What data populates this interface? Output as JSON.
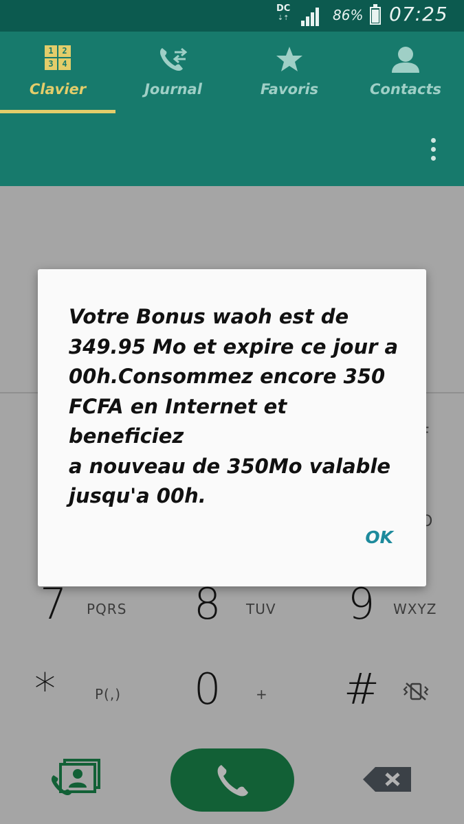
{
  "status_bar": {
    "network": "DC",
    "battery_percent": "86%",
    "battery_level": 0.86,
    "time": "07:25"
  },
  "tabs": [
    {
      "label": "Clavier",
      "icon": "keypad-icon",
      "active": true
    },
    {
      "label": "Journal",
      "icon": "call-log-icon",
      "active": false
    },
    {
      "label": "Favoris",
      "icon": "star-icon",
      "active": false
    },
    {
      "label": "Contacts",
      "icon": "person-icon",
      "active": false
    }
  ],
  "keypad_icon_digits": [
    "1",
    "2",
    "3",
    "4"
  ],
  "dialog": {
    "message_lines": [
      "Votre Bonus waoh est de",
      "349.95 Mo et expire ce jour a",
      "00h.Consommez encore 350",
      "FCFA en Internet et beneficiez",
      "a nouveau de 350Mo valable",
      "jusqu'a 00h."
    ],
    "ok_label": "OK"
  },
  "keypad": {
    "row_7": [
      {
        "digit": "7",
        "letters": "PQRS"
      },
      {
        "digit": "8",
        "letters": "TUV"
      },
      {
        "digit": "9",
        "letters": "WXYZ"
      }
    ],
    "row_star": [
      {
        "digit": "*",
        "letters": "P(,)"
      },
      {
        "digit": "0",
        "letters": "+"
      },
      {
        "digit": "#",
        "letters": ""
      }
    ],
    "peek_right_upper": "F",
    "peek_right_lower": "O"
  },
  "colors": {
    "status_bar": "#0c5a4f",
    "app_bar": "#177a6c",
    "active_tab": "#e3cd6a",
    "call_button": "#1b8a4e",
    "ok_text": "#1d8a9c"
  }
}
